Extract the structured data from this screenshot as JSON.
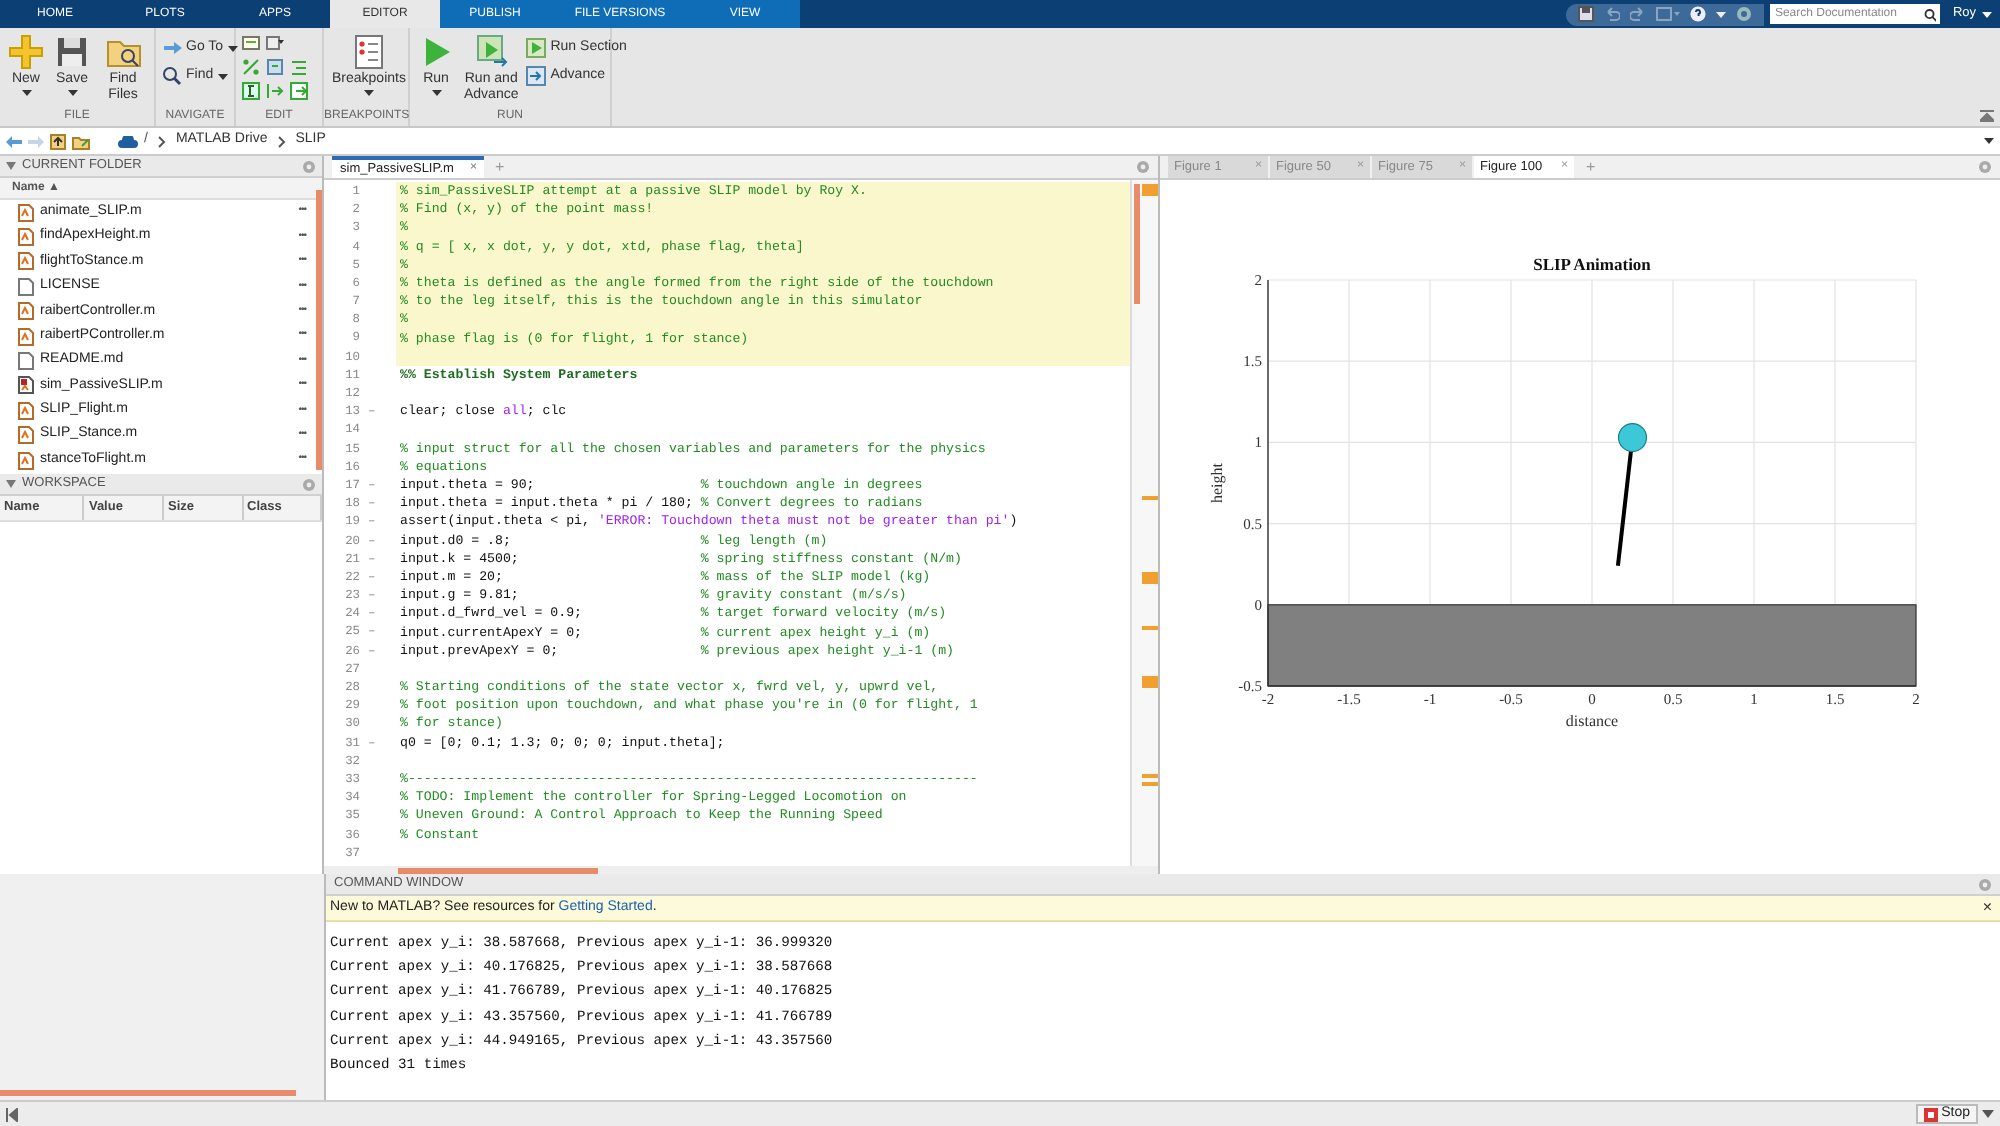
{
  "ribbon_tabs": [
    {
      "label": "HOME",
      "selected": false,
      "kind": "global"
    },
    {
      "label": "PLOTS",
      "selected": false,
      "kind": "global"
    },
    {
      "label": "APPS",
      "selected": false,
      "kind": "global"
    },
    {
      "label": "EDITOR",
      "selected": true,
      "kind": "contextual"
    },
    {
      "label": "PUBLISH",
      "selected": false,
      "kind": "contextual"
    },
    {
      "label": "FILE VERSIONS",
      "selected": false,
      "kind": "contextual"
    },
    {
      "label": "VIEW",
      "selected": false,
      "kind": "contextual"
    }
  ],
  "search": {
    "placeholder": "Search Documentation"
  },
  "user": {
    "label": "Roy"
  },
  "ribbon_groups": [
    {
      "label": "FILE",
      "buttons": [
        {
          "label": "New",
          "kind": "large",
          "dropdown": true
        },
        {
          "label": "Save",
          "kind": "large",
          "dropdown": true
        },
        {
          "label": "Find Files",
          "kind": "large",
          "dropdown": false
        }
      ]
    },
    {
      "label": "NAVIGATE",
      "buttons": [
        {
          "label": "Go To",
          "kind": "small",
          "dropdown": true
        },
        {
          "label": "Find",
          "kind": "small",
          "dropdown": true
        }
      ]
    },
    {
      "label": "EDIT"
    },
    {
      "label": "BREAKPOINTS",
      "buttons": [
        {
          "label": "Breakpoints",
          "kind": "large",
          "dropdown": true
        }
      ]
    },
    {
      "label": "RUN",
      "buttons": [
        {
          "label": "Run",
          "kind": "large",
          "dropdown": true
        },
        {
          "label": "Run and Advance",
          "kind": "large",
          "dropdown": false
        },
        {
          "label": "Run Section",
          "kind": "small",
          "dropdown": false
        },
        {
          "label": "Advance",
          "kind": "small",
          "dropdown": false
        }
      ]
    }
  ],
  "address": {
    "root": "/",
    "parts": [
      "MATLAB Drive",
      "SLIP"
    ]
  },
  "current_folder": {
    "title": "CURRENT FOLDER",
    "column": "Name ▲",
    "files": [
      {
        "name": "animate_SLIP.m",
        "kind": "script",
        "menu": "•••"
      },
      {
        "name": "findApexHeight.m",
        "kind": "script",
        "menu": "•••"
      },
      {
        "name": "flightToStance.m",
        "kind": "script",
        "menu": "•••"
      },
      {
        "name": "LICENSE",
        "kind": "text",
        "menu": "•••"
      },
      {
        "name": "raibertController.m",
        "kind": "script",
        "menu": "•••"
      },
      {
        "name": "raibertPController.m",
        "kind": "script",
        "menu": "•••"
      },
      {
        "name": "README.md",
        "kind": "text",
        "menu": "•••"
      },
      {
        "name": "sim_PassiveSLIP.m",
        "kind": "active",
        "menu": "•••"
      },
      {
        "name": "SLIP_Flight.m",
        "kind": "script",
        "menu": "•••"
      },
      {
        "name": "SLIP_Stance.m",
        "kind": "script",
        "menu": "•••"
      },
      {
        "name": "stanceToFlight.m",
        "kind": "script",
        "menu": "•••"
      }
    ]
  },
  "workspace": {
    "title": "WORKSPACE",
    "columns": [
      "Name",
      "Value",
      "Size",
      "Class"
    ]
  },
  "editor": {
    "tabs": [
      {
        "label": "sim_PassiveSLIP.m",
        "close": "×"
      }
    ],
    "new_tab": "+",
    "lines": [
      {
        "no": "1",
        "highlighted": true,
        "parts": [
          {
            "text": "% sim_PassiveSLIP attempt at a passive SLIP model by Roy X.",
            "kind": "comment"
          }
        ]
      },
      {
        "no": "2",
        "highlighted": true,
        "parts": [
          {
            "text": "% Find (x, y) of the point mass!",
            "kind": "comment"
          }
        ]
      },
      {
        "no": "3",
        "highlighted": true,
        "parts": [
          {
            "text": "%",
            "kind": "comment"
          }
        ]
      },
      {
        "no": "4",
        "highlighted": true,
        "parts": [
          {
            "text": "% q = [ x, x dot, y, y dot, xtd, phase flag, theta]",
            "kind": "comment"
          }
        ]
      },
      {
        "no": "5",
        "highlighted": true,
        "parts": [
          {
            "text": "%",
            "kind": "comment"
          }
        ]
      },
      {
        "no": "6",
        "highlighted": true,
        "parts": [
          {
            "text": "% theta is defined as the angle formed from the right side of the touchdown",
            "kind": "comment"
          }
        ]
      },
      {
        "no": "7",
        "highlighted": true,
        "parts": [
          {
            "text": "% to the leg itself, this is the touchdown angle in this simulator",
            "kind": "comment"
          }
        ]
      },
      {
        "no": "8",
        "highlighted": true,
        "parts": [
          {
            "text": "%",
            "kind": "comment"
          }
        ]
      },
      {
        "no": "9",
        "highlighted": true,
        "parts": [
          {
            "text": "% phase flag is (0 for flight, 1 for stance)",
            "kind": "comment"
          }
        ]
      },
      {
        "no": "10",
        "highlighted": true
      },
      {
        "no": "11",
        "highlighted": false,
        "parts": [
          {
            "text": "%% Establish System Parameters",
            "kind": "section"
          }
        ]
      },
      {
        "no": "12",
        "highlighted": false
      },
      {
        "no": "13",
        "marker": "–",
        "highlighted": false,
        "parts": [
          {
            "text": "clear; close ",
            "kind": "code"
          },
          {
            "text": "all",
            "kind": "keyword"
          },
          {
            "text": "; clc",
            "kind": "code"
          }
        ]
      },
      {
        "no": "14",
        "highlighted": false
      },
      {
        "no": "15",
        "highlighted": false,
        "parts": [
          {
            "text": "% input struct for all the chosen variables and parameters for the physics",
            "kind": "comment"
          }
        ]
      },
      {
        "no": "16",
        "highlighted": false,
        "parts": [
          {
            "text": "% equations",
            "kind": "comment"
          }
        ]
      },
      {
        "no": "17",
        "marker": "–",
        "highlighted": false,
        "parts": [
          {
            "text": "input.theta = 90;",
            "kind": "code"
          }
        ],
        "comment": "% touchdown angle in degrees"
      },
      {
        "no": "18",
        "marker": "–",
        "highlighted": false,
        "parts": [
          {
            "text": "input.theta = input.theta * pi / 180;",
            "kind": "code"
          }
        ],
        "comment": "% Convert degrees to radians"
      },
      {
        "no": "19",
        "marker": "–",
        "highlighted": false,
        "parts": [
          {
            "text": "assert(input.theta < pi, ",
            "kind": "code"
          },
          {
            "text": "'ERROR: Touchdown theta must not be greater than pi'",
            "kind": "string"
          },
          {
            "text": ")",
            "kind": "code"
          }
        ]
      },
      {
        "no": "20",
        "marker": "–",
        "highlighted": false,
        "parts": [
          {
            "text": "input.d0 = .8;",
            "kind": "code"
          }
        ],
        "comment": "% leg length (m)"
      },
      {
        "no": "21",
        "marker": "–",
        "highlighted": false,
        "parts": [
          {
            "text": "input.k = 4500;",
            "kind": "code"
          }
        ],
        "comment": "% spring stiffness constant (N/m)"
      },
      {
        "no": "22",
        "marker": "–",
        "highlighted": false,
        "parts": [
          {
            "text": "input.m = 20;",
            "kind": "code"
          }
        ],
        "comment": "% mass of the SLIP model (kg)"
      },
      {
        "no": "23",
        "marker": "–",
        "highlighted": false,
        "parts": [
          {
            "text": "input.g = 9.81;",
            "kind": "code"
          }
        ],
        "comment": "% gravity constant (m/s/s)"
      },
      {
        "no": "24",
        "marker": "–",
        "highlighted": false,
        "parts": [
          {
            "text": "input.d_fwrd_vel = 0.9;",
            "kind": "code"
          }
        ],
        "comment": "% target forward velocity (m/s)"
      },
      {
        "no": "25",
        "marker": "–",
        "highlighted": false,
        "parts": [
          {
            "text": "input.currentApexY = 0;",
            "kind": "code"
          }
        ],
        "comment": "% current apex height y_i (m)"
      },
      {
        "no": "26",
        "marker": "–",
        "highlighted": false,
        "parts": [
          {
            "text": "input.prevApexY = 0;",
            "kind": "code"
          }
        ],
        "comment": "% previous apex height y_i-1 (m)"
      },
      {
        "no": "27",
        "highlighted": false
      },
      {
        "no": "28",
        "highlighted": false,
        "parts": [
          {
            "text": "% Starting conditions of the state vector x, fwrd vel, y, upwrd vel,",
            "kind": "comment"
          }
        ]
      },
      {
        "no": "29",
        "highlighted": false,
        "parts": [
          {
            "text": "% foot position upon touchdown, and what phase you're in (0 for flight, 1",
            "kind": "comment"
          }
        ]
      },
      {
        "no": "30",
        "highlighted": false,
        "parts": [
          {
            "text": "% for stance)",
            "kind": "comment"
          }
        ]
      },
      {
        "no": "31",
        "marker": "–",
        "highlighted": false,
        "parts": [
          {
            "text": "q0 = [0; 0.1; 1.3; 0; 0; 0; input.theta];",
            "kind": "code"
          }
        ]
      },
      {
        "no": "32",
        "highlighted": false
      },
      {
        "no": "33",
        "highlighted": false,
        "parts": [
          {
            "text": "%------------------------------------------------------------------------",
            "kind": "comment"
          }
        ]
      },
      {
        "no": "34",
        "highlighted": false,
        "parts": [
          {
            "text": "% TODO: Implement the controller for Spring-Legged Locomotion on",
            "kind": "comment"
          }
        ]
      },
      {
        "no": "35",
        "highlighted": false,
        "parts": [
          {
            "text": "% Uneven Ground: A Control Approach to Keep the Running Speed",
            "kind": "comment"
          }
        ]
      },
      {
        "no": "36",
        "highlighted": false,
        "parts": [
          {
            "text": "% Constant",
            "kind": "comment"
          }
        ]
      },
      {
        "no": "37",
        "highlighted": false
      }
    ]
  },
  "figure": {
    "tabs": [
      {
        "label": "Figure 1",
        "selected": false
      },
      {
        "label": "Figure 50",
        "selected": false
      },
      {
        "label": "Figure 75",
        "selected": false
      },
      {
        "label": "Figure 100",
        "selected": true
      }
    ],
    "close": "×",
    "new_tab": "+",
    "chart_data": {
      "type": "line",
      "title": "SLIP Animation",
      "xlabel": "distance",
      "ylabel": "height",
      "x": [
        0.16,
        0.25
      ],
      "series": [
        {
          "color": "#000000",
          "values": [
            0.24,
            1.03
          ]
        }
      ],
      "grid": true,
      "xlim": [
        -2,
        2
      ],
      "ylim": [
        -0.5,
        2
      ],
      "xticks": [
        {
          "value": -2,
          "label": "-2"
        },
        {
          "value": -1.5,
          "label": "-1.5"
        },
        {
          "value": -1,
          "label": "-1"
        },
        {
          "value": -0.5,
          "label": "-0.5"
        },
        {
          "value": 0,
          "label": "0"
        },
        {
          "value": 0.5,
          "label": "0.5"
        },
        {
          "value": 1,
          "label": "1"
        },
        {
          "value": 1.5,
          "label": "1.5"
        },
        {
          "value": 2,
          "label": "2"
        }
      ],
      "yticks": [
        {
          "value": -0.5,
          "label": "-0.5"
        },
        {
          "value": 0,
          "label": "0"
        },
        {
          "value": 0.5,
          "label": "0.5"
        },
        {
          "value": 1,
          "label": "1"
        },
        {
          "value": 1.5,
          "label": "1.5"
        },
        {
          "value": 2,
          "label": "2"
        }
      ]
    }
  },
  "command_window": {
    "title": "COMMAND WINDOW",
    "info": {
      "text": "New to MATLAB? See resources for ",
      "link": "Getting Started",
      "after": "."
    },
    "close": "×",
    "output": [
      "Current apex y_i: 38.587668, Previous apex y_i-1: 36.999320",
      "Current apex y_i: 40.176825, Previous apex y_i-1: 38.587668",
      "Current apex y_i: 41.766789, Previous apex y_i-1: 40.176825",
      "Current apex y_i: 43.357560, Previous apex y_i-1: 41.766789",
      "Current apex y_i: 44.949165, Previous apex y_i-1: 43.357560",
      "Bounced 31 times"
    ]
  },
  "status_bar": {
    "stop": "Stop"
  }
}
